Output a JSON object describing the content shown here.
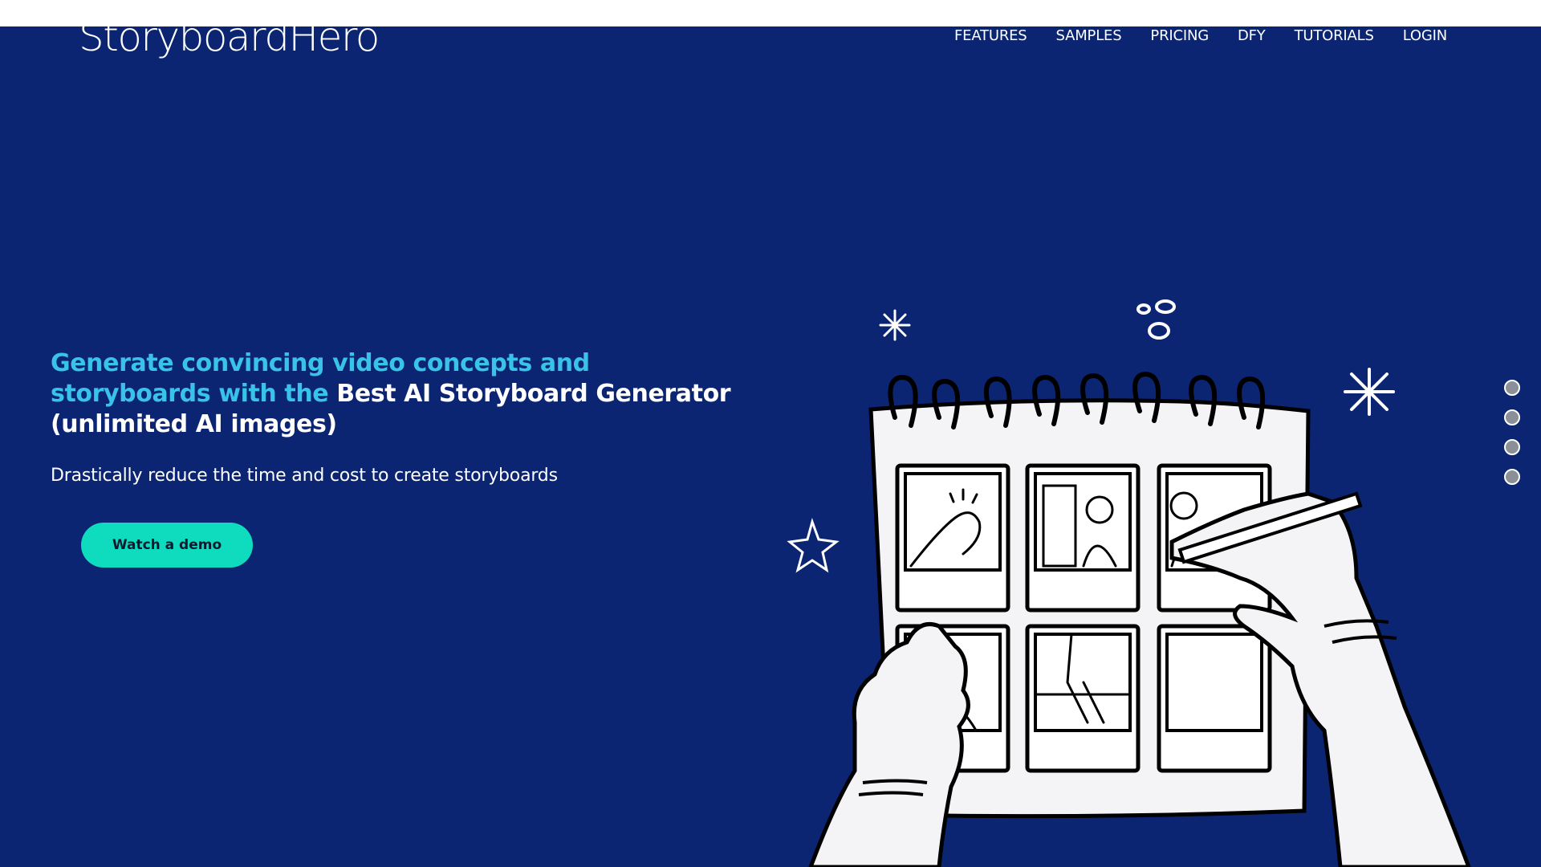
{
  "header": {
    "logo_text": "StoryboardHero",
    "nav": [
      "FEATURES",
      "SAMPLES",
      "PRICING",
      "DFY",
      "TUTORIALS",
      "LOGIN"
    ]
  },
  "hero": {
    "title_accent": "Generate convincing video concepts and storyboards with the",
    "title_strong": "Best AI Storyboard Generator (unlimited AI images)",
    "subtitle": "Drastically reduce the time and cost to create storyboards",
    "cta_label": "Watch a demo"
  },
  "colors": {
    "background": "#0b2572",
    "accent": "#3ac3e8",
    "cta": "#0fdcbf"
  },
  "icons": [
    "lightbulb-icon",
    "sparkle-icon",
    "star-icon"
  ],
  "section_nav": {
    "count": 4
  }
}
